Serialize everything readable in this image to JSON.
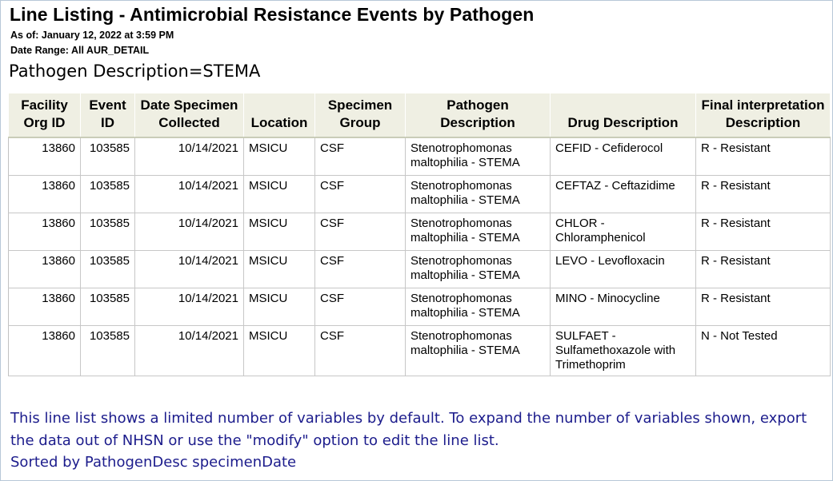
{
  "report": {
    "title": "Line Listing - Antimicrobial Resistance Events by Pathogen",
    "as_of": "As of: January 12, 2022 at 3:59 PM",
    "date_range": "Date Range: All AUR_DETAIL",
    "by_group": "Pathogen Description=STEMA"
  },
  "table": {
    "headers": [
      "Facility Org ID",
      "Event ID",
      "Date Specimen Collected",
      "Location",
      "Specimen Group",
      "Pathogen Description",
      "Drug Description",
      "Final interpretation Description"
    ],
    "rows": [
      [
        "13860",
        "103585",
        "10/14/2021",
        "MSICU",
        "CSF",
        "Stenotrophomonas maltophilia - STEMA",
        "CEFID - Cefiderocol",
        "R - Resistant"
      ],
      [
        "13860",
        "103585",
        "10/14/2021",
        "MSICU",
        "CSF",
        "Stenotrophomonas maltophilia - STEMA",
        "CEFTAZ - Ceftazidime",
        "R - Resistant"
      ],
      [
        "13860",
        "103585",
        "10/14/2021",
        "MSICU",
        "CSF",
        "Stenotrophomonas maltophilia - STEMA",
        "CHLOR - Chloramphenicol",
        "R - Resistant"
      ],
      [
        "13860",
        "103585",
        "10/14/2021",
        "MSICU",
        "CSF",
        "Stenotrophomonas maltophilia - STEMA",
        "LEVO - Levofloxacin",
        "R - Resistant"
      ],
      [
        "13860",
        "103585",
        "10/14/2021",
        "MSICU",
        "CSF",
        "Stenotrophomonas maltophilia - STEMA",
        "MINO - Minocycline",
        "R - Resistant"
      ],
      [
        "13860",
        "103585",
        "10/14/2021",
        "MSICU",
        "CSF",
        "Stenotrophomonas maltophilia - STEMA",
        "SULFAET - Sulfamethoxazole with Trimethoprim",
        "N - Not Tested"
      ]
    ]
  },
  "footer": {
    "note": "This line list shows a limited number of variables by default. To expand the number of variables shown, export the data out of NHSN or use the \"modify\" option to edit the line list.",
    "sorted_by": "Sorted by PathogenDesc specimenDate"
  }
}
